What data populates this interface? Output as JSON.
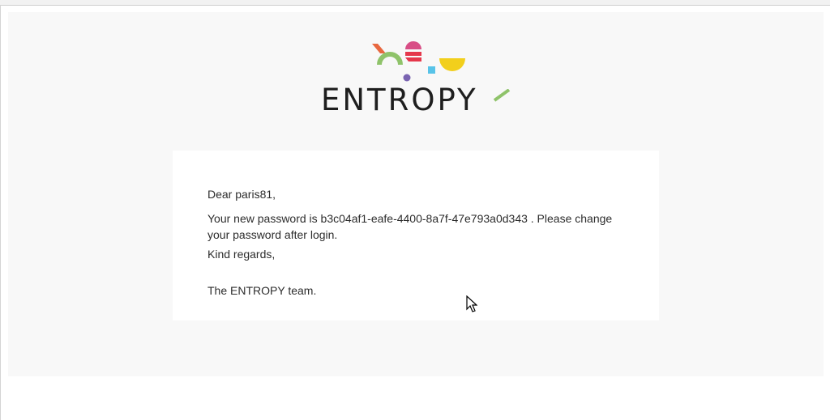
{
  "brand": {
    "name": "ENTROPY",
    "colors": {
      "orange": "#e8673f",
      "green": "#8fc36a",
      "pink": "#d84e86",
      "red": "#e5374b",
      "blue": "#58c3e8",
      "purple": "#7a64b1",
      "yellow": "#f2cf1c",
      "text": "#1e1e1e"
    }
  },
  "email": {
    "greeting": "Dear paris81,",
    "message": "Your new password is b3c04af1-eafe-4400-8a7f-47e793a0d343 . Please change your password after login.",
    "closing": "Kind regards,",
    "signature": "The ENTROPY team."
  },
  "pointer": {
    "icon": "mouse-cursor-icon"
  }
}
